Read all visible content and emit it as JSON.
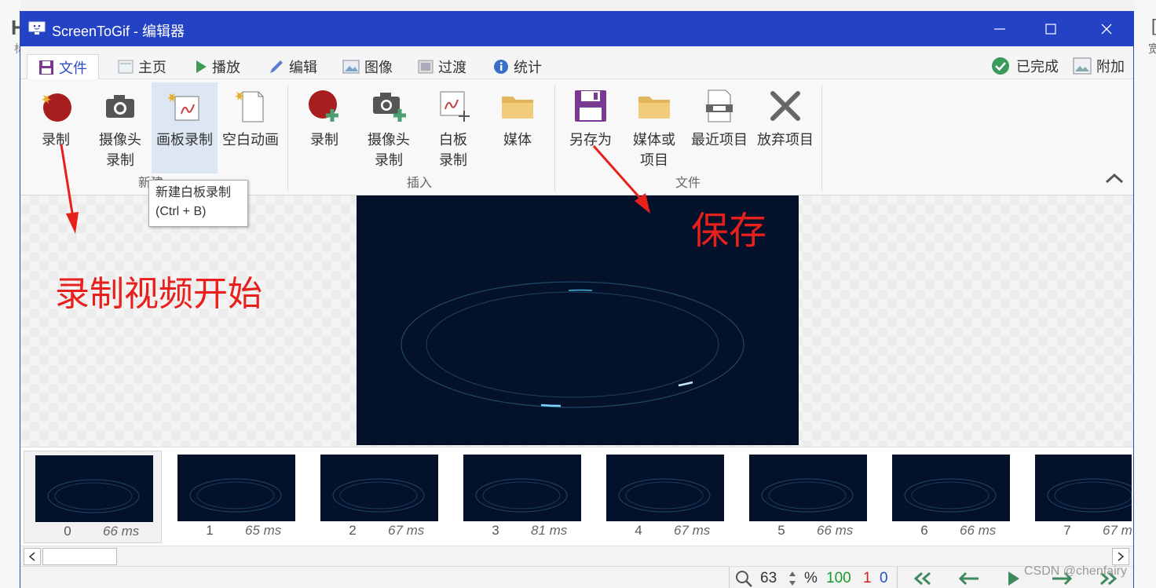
{
  "background": {
    "left_text_1": "H",
    "left_text_2": "标",
    "right_text_1": "[",
    "right_text_2": "宽"
  },
  "window": {
    "title": "ScreenToGif - 编辑器"
  },
  "tabs": [
    {
      "label": "文件",
      "icon": "save-icon"
    },
    {
      "label": "主页",
      "icon": "home-icon"
    },
    {
      "label": "播放",
      "icon": "play-icon"
    },
    {
      "label": "编辑",
      "icon": "pencil-icon"
    },
    {
      "label": "图像",
      "icon": "image-icon"
    },
    {
      "label": "过渡",
      "icon": "transition-icon"
    },
    {
      "label": "统计",
      "icon": "info-icon"
    }
  ],
  "tab_right": {
    "done_label": "已完成",
    "extra_label": "附加"
  },
  "ribbon": {
    "new_group": {
      "label": "新建",
      "record": "录制",
      "webcam_line1": "摄像头",
      "webcam_line2": "录制",
      "board": "画板录制",
      "blank": "空白动画"
    },
    "insert_group": {
      "label": "插入",
      "record": "录制",
      "webcam_line1": "摄像头",
      "webcam_line2": "录制",
      "board_line1": "白板",
      "board_line2": "录制",
      "media": "媒体"
    },
    "file_group": {
      "label": "文件",
      "save_as": "另存为",
      "media_line1": "媒体或",
      "media_line2": "项目",
      "recent": "最近项目",
      "discard": "放弃项目"
    }
  },
  "tooltip": {
    "line1": "新建白板录制",
    "line2": "(Ctrl + B)"
  },
  "annotations": {
    "record_start": "录制视频开始",
    "save": "保存"
  },
  "frames": [
    {
      "index": "0",
      "delay": "66 ms"
    },
    {
      "index": "1",
      "delay": "65 ms"
    },
    {
      "index": "2",
      "delay": "67 ms"
    },
    {
      "index": "3",
      "delay": "81 ms"
    },
    {
      "index": "4",
      "delay": "67 ms"
    },
    {
      "index": "5",
      "delay": "66 ms"
    },
    {
      "index": "6",
      "delay": "66 ms"
    },
    {
      "index": "7",
      "delay": "67 m"
    }
  ],
  "status": {
    "zoom": "63",
    "percent": "%",
    "total_frames": "100",
    "selected": "1",
    "current": "0",
    "colors": {
      "total": "#1a9a2a",
      "selected": "#d02020",
      "current": "#2050c8"
    }
  },
  "watermark": "CSDN @chenfairy"
}
